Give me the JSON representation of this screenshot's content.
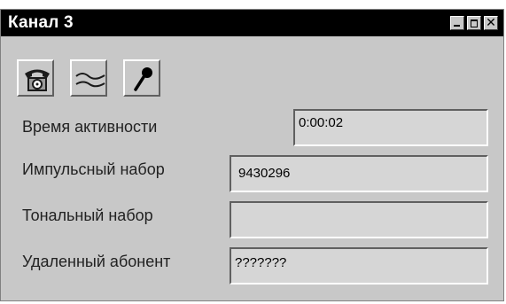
{
  "window": {
    "title": "Канал 3"
  },
  "titlebar_controls": {
    "close_glyph": "✕"
  },
  "toolbar": [
    {
      "icon": "telephone-icon"
    },
    {
      "icon": "line-wave-icon"
    },
    {
      "icon": "microphone-icon"
    }
  ],
  "fields": {
    "active_time": {
      "label": "Время активности",
      "value": "0:00:02"
    },
    "pulse_dial": {
      "label": "Импульсный набор",
      "value": "9430296"
    },
    "tone_dial": {
      "label": "Тональный набор",
      "value": ""
    },
    "remote_subscriber": {
      "label": "Удаленный абонент",
      "value": "???????"
    }
  }
}
